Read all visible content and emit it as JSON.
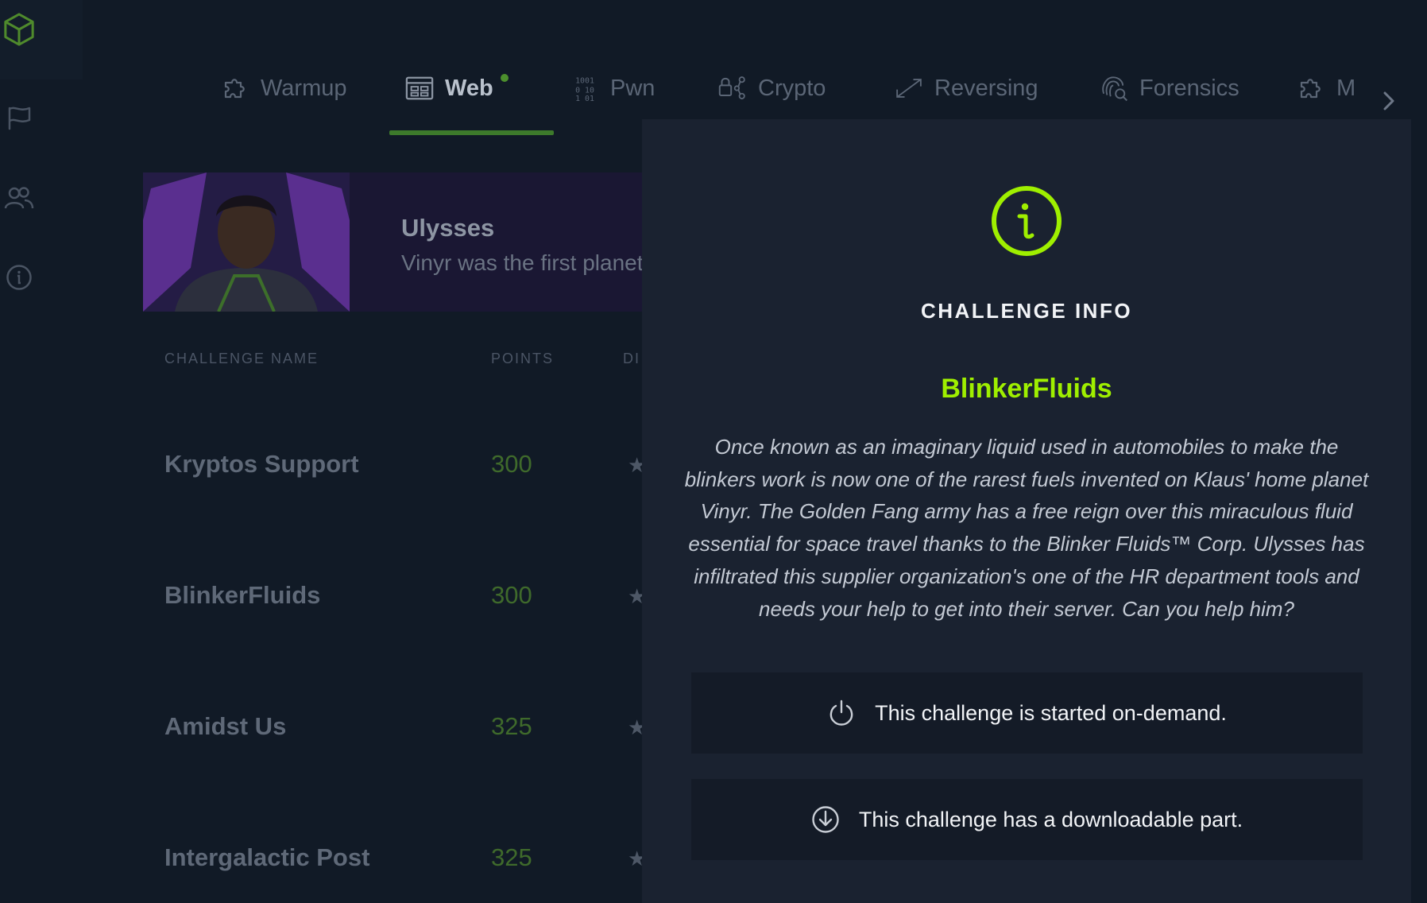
{
  "rail": {
    "items": [
      {
        "icon": "logo-cube-icon"
      },
      {
        "icon": "flag-icon"
      },
      {
        "icon": "users-icon"
      },
      {
        "icon": "info-icon"
      }
    ],
    "colors": {
      "logo": "#4f8a2c",
      "icon": "#4a5463"
    }
  },
  "tabs": {
    "items": [
      {
        "label": "Warmup",
        "icon": "puzzle-icon"
      },
      {
        "label": "Web",
        "icon": "browser-icon",
        "active": true,
        "badge": true
      },
      {
        "label": "Pwn",
        "icon": "binary-icon"
      },
      {
        "label": "Crypto",
        "icon": "lock-share-icon"
      },
      {
        "label": "Reversing",
        "icon": "arrows-diagonal-icon"
      },
      {
        "label": "Forensics",
        "icon": "fingerprint-search-icon"
      },
      {
        "label": "M",
        "icon": "puzzle-icon"
      }
    ],
    "next_icon": "chevron-right-icon"
  },
  "hero": {
    "title": "Ulysses",
    "subtitle": "Vinyr was the first planet"
  },
  "table": {
    "headers": {
      "name": "CHALLENGE NAME",
      "points": "POINTS",
      "difficulty": "DI"
    },
    "rows": [
      {
        "name": "Kryptos Support",
        "points": "300"
      },
      {
        "name": "BlinkerFluids",
        "points": "300"
      },
      {
        "name": "Amidst Us",
        "points": "325"
      },
      {
        "name": "Intergalactic Post",
        "points": "325"
      }
    ],
    "star": "★"
  },
  "modal": {
    "heading": "CHALLENGE INFO",
    "title": "BlinkerFluids",
    "description": "Once known as an imaginary liquid used in automobiles to make the blinkers work is now one of the rarest fuels invented on Klaus' home planet Vinyr. The Golden Fang army has a free reign over this miraculous fluid essential for space travel thanks to the Blinker Fluids™ Corp. Ulysses has infiltrated this supplier organization's one of the HR department tools and needs your help to get into their server. Can you help him?",
    "features": [
      {
        "icon": "power-icon",
        "text": "This challenge is started on-demand."
      },
      {
        "icon": "download-icon",
        "text": "This challenge has a downloadable part."
      }
    ],
    "accent": "#9fef00"
  }
}
